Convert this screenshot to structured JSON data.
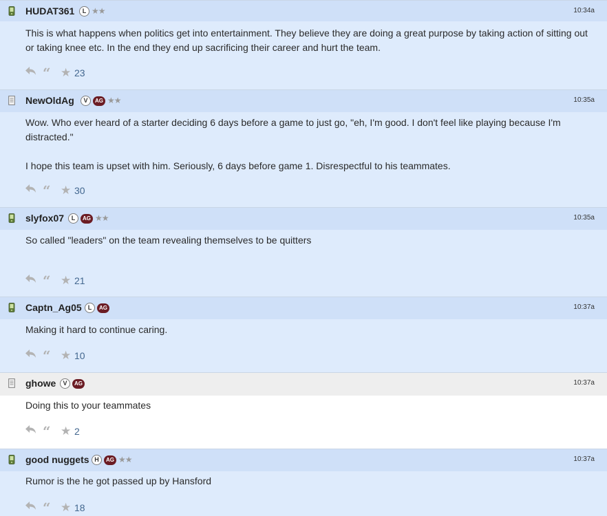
{
  "posts": [
    {
      "username": "HUDAT361",
      "badges": [
        "L"
      ],
      "stars": "★★",
      "time": "10:34a",
      "device": "phone-icon",
      "body": [
        "This is what happens when politics get into entertainment. They believe they are doing a great purpose by taking action of sitting out or taking knee etc. In the end they end up sacrificing their career and hurt the team."
      ],
      "star_count": "23"
    },
    {
      "username": "NewOldAg",
      "badges": [
        "V",
        "AG"
      ],
      "stars": "★★",
      "time": "10:35a",
      "device": "document-icon",
      "body": [
        "Wow. Who ever heard of a starter deciding 6 days before a game to just go, \"eh, I'm good. I don't feel like playing because I'm distracted.\"",
        "I hope this team is upset with him. Seriously, 6 days before game 1. Disrespectful to his teammates."
      ],
      "star_count": "30"
    },
    {
      "username": "slyfox07",
      "badges": [
        "L",
        "AG"
      ],
      "stars": "★★",
      "time": "10:35a",
      "device": "phone-icon",
      "body": [
        "So called \"leaders\" on the team revealing themselves to be quitters"
      ],
      "star_count": "21"
    },
    {
      "username": "Captn_Ag05",
      "badges": [
        "L",
        "AG"
      ],
      "stars": "",
      "time": "10:37a",
      "device": "phone-icon",
      "body": [
        "Making it hard to continue caring."
      ],
      "star_count": "10"
    },
    {
      "username": "ghowe",
      "badges": [
        "V",
        "AG"
      ],
      "stars": "",
      "time": "10:37a",
      "device": "document-icon",
      "body": [
        "Doing this to your teammates"
      ],
      "star_count": "2"
    },
    {
      "username": "good nuggets",
      "badges": [
        "H",
        "AG"
      ],
      "stars": "★★",
      "time": "10:37a",
      "device": "phone-icon",
      "body": [
        "Rumor is the he got passed up by Hansford"
      ],
      "star_count": "18"
    }
  ],
  "icons": {
    "reply": "reply-arrow-icon",
    "quote": "quote-icon",
    "star": "star-icon"
  },
  "colors": {
    "highlight_header": "#cfe0f8",
    "highlight_body": "#deebfc",
    "plain_header": "#eeeeee",
    "plain_body": "#ffffff",
    "ag_badge": "#6b1c24",
    "star_count": "#43678f"
  }
}
